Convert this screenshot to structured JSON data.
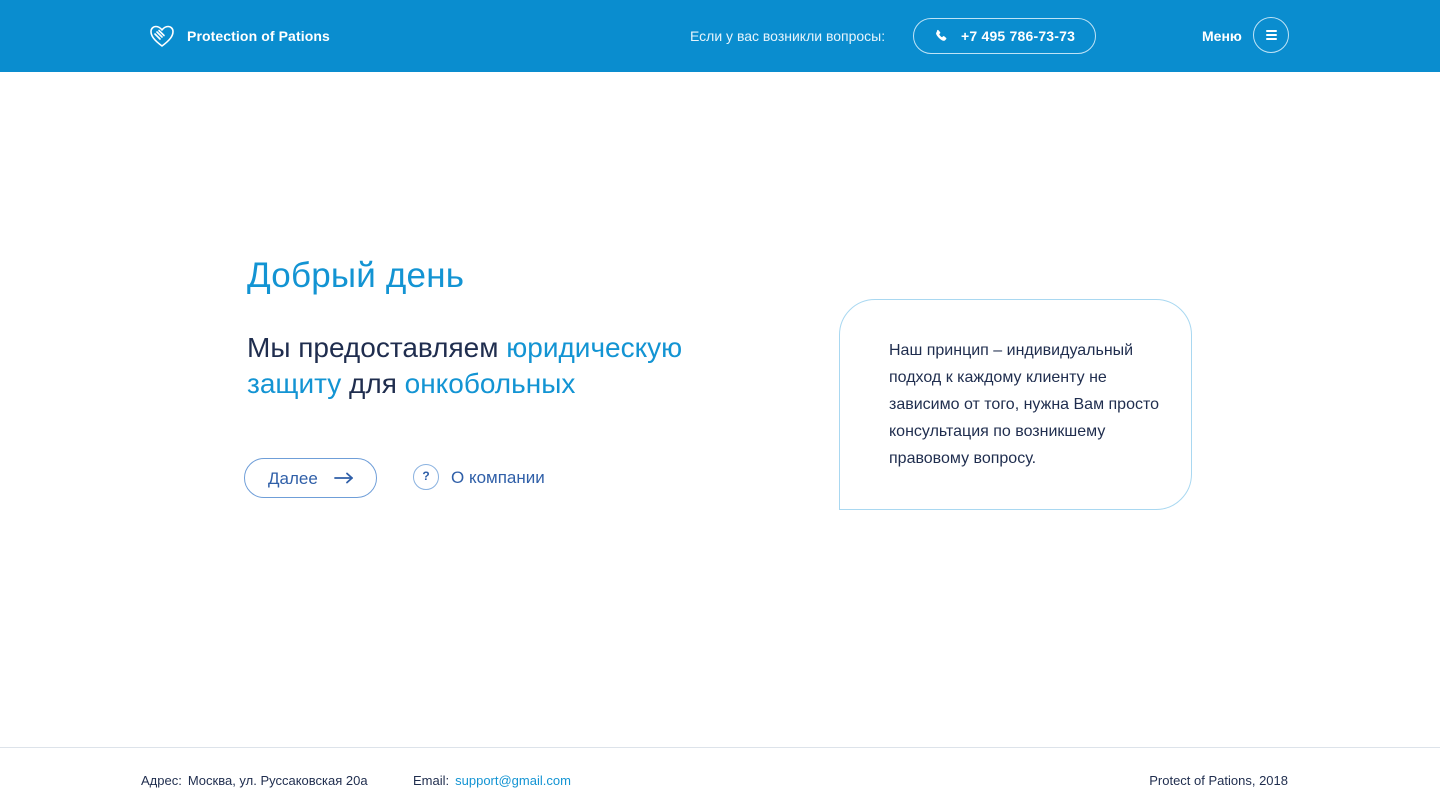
{
  "header": {
    "brand": "Protection of Pations",
    "question_text": "Если у вас возникли вопросы:",
    "phone": "+7 495 786-73-73",
    "menu_label": "Меню"
  },
  "hero": {
    "greeting": "Добрый день",
    "tagline_part1": "Мы предоставляем ",
    "tagline_hl1": "юридическую защиту",
    "tagline_part2": " для ",
    "tagline_hl2": "онкобольных",
    "next_label": "Далее",
    "about_icon": "?",
    "about_label": "О компании"
  },
  "card": {
    "text": "Наш принцип – индивидуальный подход к каждому клиенту не зависимо от того, нужна Вам просто консультация по возникшему правовому вопросу."
  },
  "footer": {
    "address_label": "Адрес:",
    "address_value": "Москва, ул. Руссаковская 20а",
    "email_label": "Email:",
    "email_value": "support@gmail.com",
    "copyright": "Protect of Pations, 2018"
  },
  "colors": {
    "header_bg": "#0a8dcf",
    "accent": "#1394d3",
    "text_dark": "#1f2d4e",
    "button_text": "#2f5fa8"
  },
  "icons": {
    "logo": "heart-hands-icon",
    "phone": "phone-icon",
    "menu": "hamburger-icon",
    "next": "arrow-right-icon",
    "about": "question-circle-icon"
  }
}
